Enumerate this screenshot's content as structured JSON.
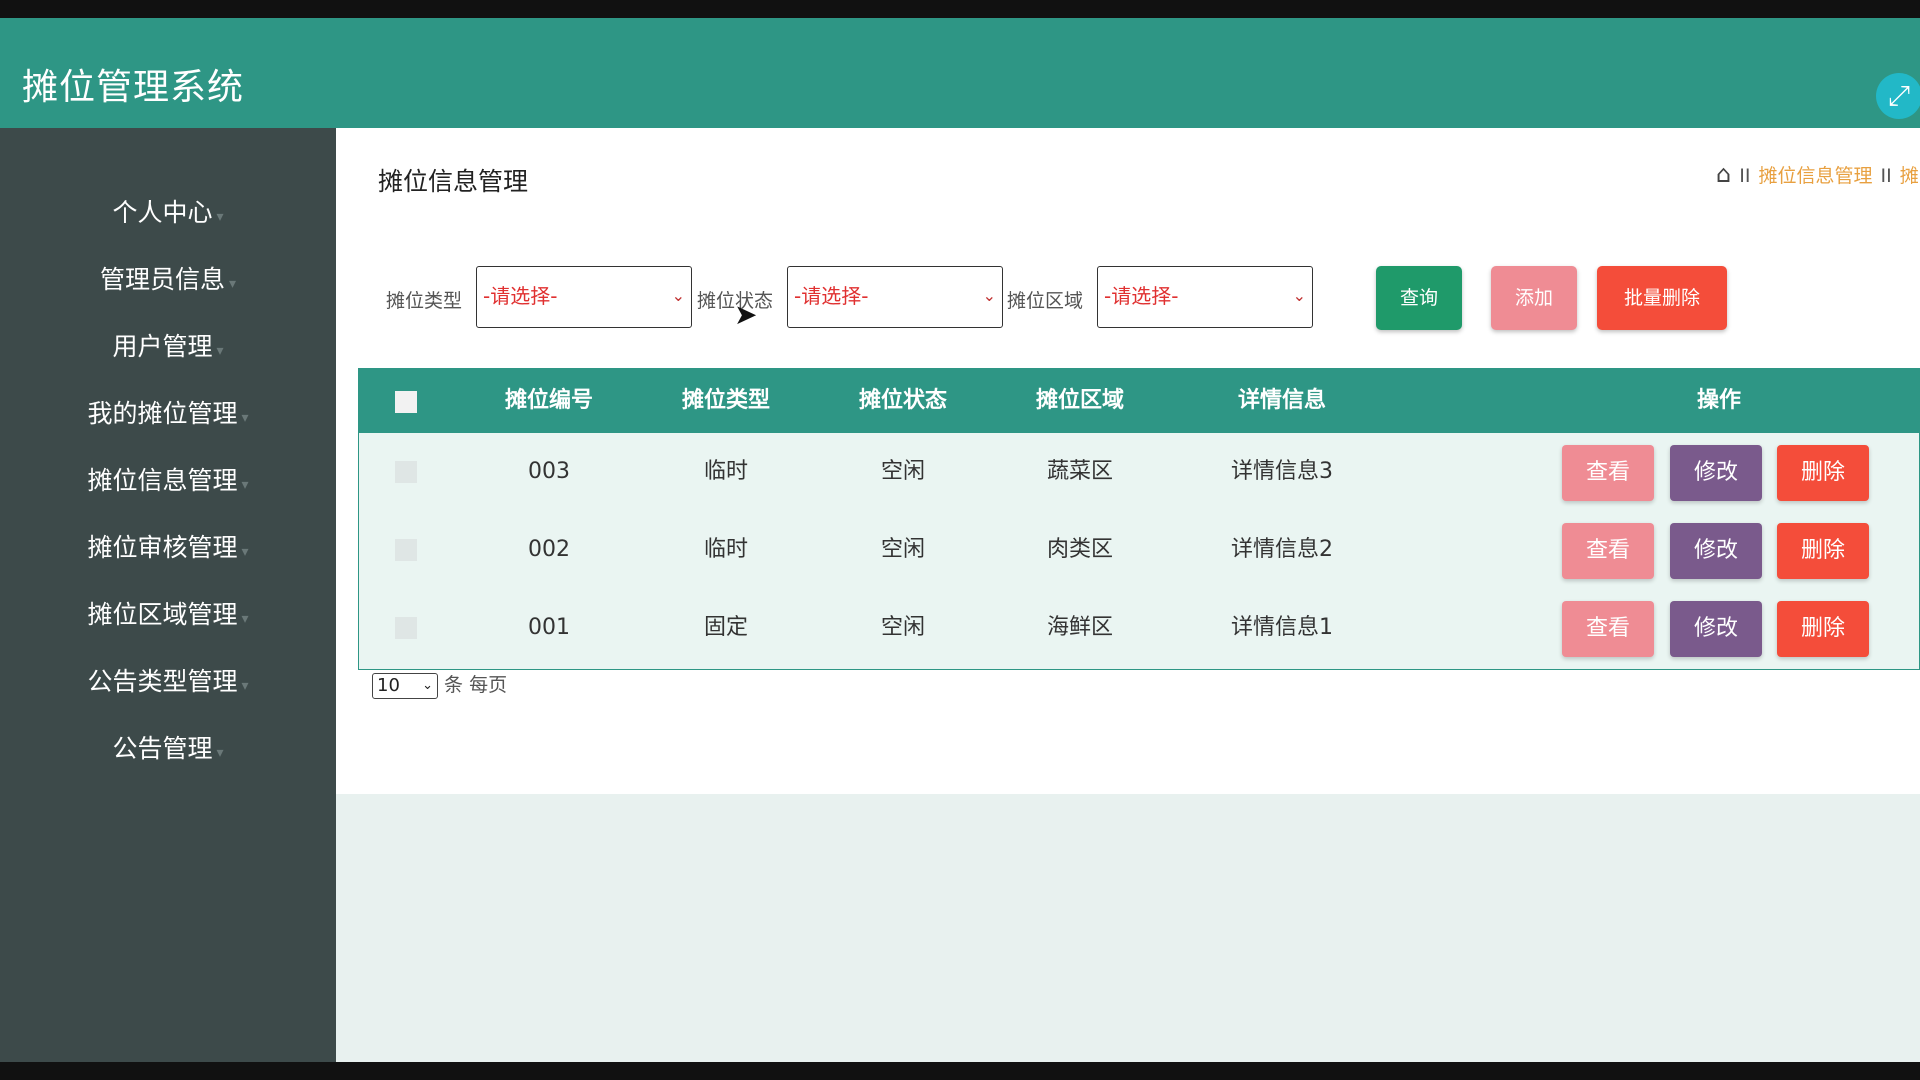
{
  "app": {
    "title": "摊位管理系统"
  },
  "sidebar": {
    "items": [
      {
        "label": "个人中心"
      },
      {
        "label": "管理员信息"
      },
      {
        "label": "用户管理"
      },
      {
        "label": "我的摊位管理"
      },
      {
        "label": "摊位信息管理"
      },
      {
        "label": "摊位审核管理"
      },
      {
        "label": "摊位区域管理"
      },
      {
        "label": "公告类型管理"
      },
      {
        "label": "公告管理"
      }
    ]
  },
  "main": {
    "page_title": "摊位信息管理",
    "breadcrumb": {
      "sep": "II",
      "current": "摊位信息管理",
      "next": "摊"
    }
  },
  "filters": {
    "type_label": "摊位类型",
    "status_label": "摊位状态",
    "area_label": "摊位区域",
    "type_value": "-请选择-",
    "status_value": "-请选择-",
    "area_value": "-请选择-"
  },
  "buttons": {
    "query": "查询",
    "add": "添加",
    "batch_delete": "批量删除",
    "view": "查看",
    "edit": "修改",
    "delete": "删除"
  },
  "table": {
    "headers": [
      "摊位编号",
      "摊位类型",
      "摊位状态",
      "摊位区域",
      "详情信息",
      "操作"
    ],
    "rows": [
      {
        "id": "003",
        "type": "临时",
        "status": "空闲",
        "area": "蔬菜区",
        "detail": "详情信息3"
      },
      {
        "id": "002",
        "type": "临时",
        "status": "空闲",
        "area": "肉类区",
        "detail": "详情信息2"
      },
      {
        "id": "001",
        "type": "固定",
        "status": "空闲",
        "area": "海鲜区",
        "detail": "详情信息1"
      }
    ]
  },
  "pager": {
    "page_size": "10",
    "suffix": "条 每页"
  },
  "colors": {
    "header": "#2e9685",
    "sidebar": "#3d4a4a",
    "query": "#1f9a6a",
    "add": "#ef8c94",
    "batch_delete": "#f44d3a",
    "view": "#ef8c94",
    "edit": "#7a5a8c",
    "delete": "#f44d3a"
  }
}
